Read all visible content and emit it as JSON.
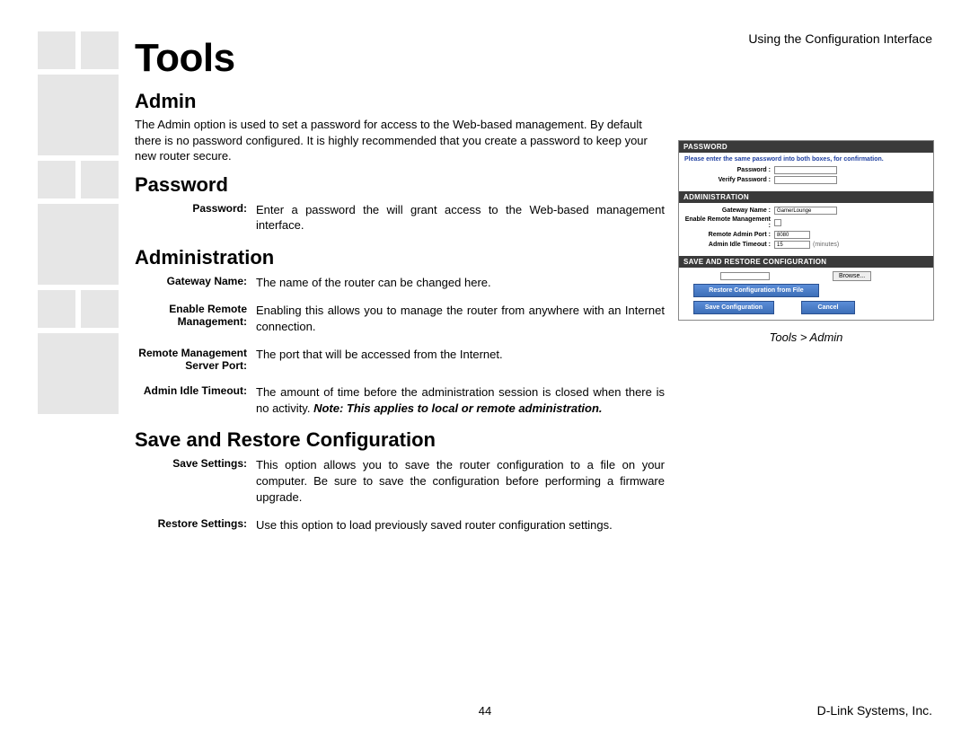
{
  "header": {
    "right": "Using the Configuration Interface"
  },
  "h_tools": "Tools",
  "sections": {
    "admin": {
      "title": "Admin",
      "text": "The Admin option is used to set a password for access to the Web-based management. By default there is no password configured. It is highly recommended that you create a password to keep your new router secure."
    },
    "password": {
      "title": "Password",
      "rows": [
        {
          "label": "Password:",
          "text": "Enter a password the will grant access to the Web-based management interface."
        }
      ]
    },
    "administration": {
      "title": "Administration",
      "rows": [
        {
          "label": "Gateway Name:",
          "text": "The name of the router can be changed here."
        },
        {
          "label": "Enable Remote Management:",
          "text": "Enabling this allows you to manage the router from anywhere with an Internet connection."
        },
        {
          "label": "Remote Management Server Port:",
          "text": "The port that will be accessed from the Internet."
        },
        {
          "label": "Admin Idle Timeout:",
          "text": "The amount of time before the administration session is closed when there is no activity. ",
          "note": "Note: This applies to local or remote administration."
        }
      ]
    },
    "saverestore": {
      "title": "Save and Restore Configuration",
      "rows": [
        {
          "label": "Save Settings:",
          "text": "This option allows you to save the router configuration to a file on your computer. Be sure to save the configuration before performing a firmware upgrade."
        },
        {
          "label": "Restore Settings:",
          "text": "Use this option to load previously saved router configuration settings."
        }
      ]
    }
  },
  "figure": {
    "panels": {
      "password": {
        "hdr": "PASSWORD",
        "note": "Please enter the same password into both boxes, for confirmation.",
        "rows": [
          {
            "label": "Password :"
          },
          {
            "label": "Verify Password :"
          }
        ]
      },
      "admin": {
        "hdr": "ADMINISTRATION",
        "rows": [
          {
            "label": "Gateway Name :",
            "value": "GamerLounge"
          },
          {
            "label": "Enable Remote Management :",
            "checkbox": true
          },
          {
            "label": "Remote Admin Port :",
            "value": "8080"
          },
          {
            "label": "Admin Idle Timeout :",
            "value": "15",
            "units": "(minutes)"
          }
        ]
      },
      "save": {
        "hdr": "SAVE AND RESTORE CONFIGURATION",
        "browse": "Browse...",
        "restore_btn": "Restore Configuration from File",
        "save_btn": "Save Configuration",
        "cancel_btn": "Cancel"
      }
    },
    "caption": "Tools > Admin"
  },
  "footer": {
    "page": "44",
    "right": "D-Link Systems, Inc."
  }
}
